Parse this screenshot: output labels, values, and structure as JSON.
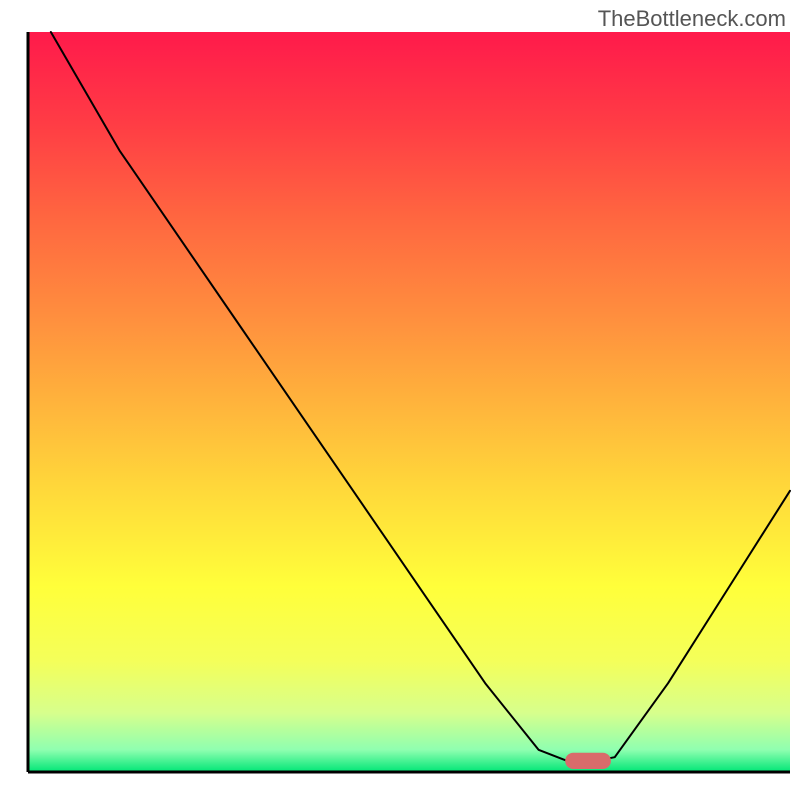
{
  "watermark": "TheBottleneck.com",
  "chart_data": {
    "type": "line",
    "title": "",
    "xlabel": "",
    "ylabel": "",
    "xlim": [
      0,
      100
    ],
    "ylim": [
      0,
      100
    ],
    "legend": false,
    "grid": false,
    "background_type": "vertical-gradient",
    "gradient_stops": [
      {
        "offset": 0.0,
        "color": "#ff1a4b"
      },
      {
        "offset": 0.12,
        "color": "#ff3b45"
      },
      {
        "offset": 0.25,
        "color": "#ff6640"
      },
      {
        "offset": 0.38,
        "color": "#ff8d3e"
      },
      {
        "offset": 0.5,
        "color": "#ffb33c"
      },
      {
        "offset": 0.62,
        "color": "#ffd93a"
      },
      {
        "offset": 0.75,
        "color": "#ffff3a"
      },
      {
        "offset": 0.85,
        "color": "#f4ff5a"
      },
      {
        "offset": 0.92,
        "color": "#d7ff8c"
      },
      {
        "offset": 0.97,
        "color": "#8fffb0"
      },
      {
        "offset": 1.0,
        "color": "#00e676"
      }
    ],
    "series": [
      {
        "name": "bottleneck-curve",
        "color": "#000000",
        "stroke_width": 2,
        "points": [
          {
            "x": 3,
            "y": 100
          },
          {
            "x": 12,
            "y": 84
          },
          {
            "x": 20,
            "y": 72
          },
          {
            "x": 28,
            "y": 60
          },
          {
            "x": 36,
            "y": 48
          },
          {
            "x": 44,
            "y": 36
          },
          {
            "x": 52,
            "y": 24
          },
          {
            "x": 60,
            "y": 12
          },
          {
            "x": 67,
            "y": 3
          },
          {
            "x": 72,
            "y": 1
          },
          {
            "x": 77,
            "y": 2
          },
          {
            "x": 84,
            "y": 12
          },
          {
            "x": 92,
            "y": 25
          },
          {
            "x": 100,
            "y": 38
          }
        ]
      }
    ],
    "marker": {
      "name": "optimal-point",
      "shape": "rounded-rect",
      "x": 73.5,
      "y": 1.5,
      "width": 6,
      "height": 2.2,
      "fill": "#d96b6b"
    },
    "axes": {
      "left": {
        "visible": true,
        "color": "#000000",
        "width": 3
      },
      "bottom": {
        "visible": true,
        "color": "#000000",
        "width": 3
      },
      "right": {
        "visible": false
      },
      "top": {
        "visible": false
      }
    }
  }
}
